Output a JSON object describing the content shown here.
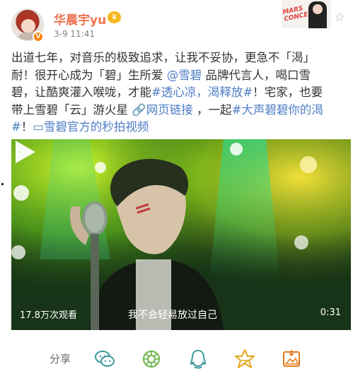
{
  "header": {
    "username": "华晨宇yu",
    "timestamp": "3-9 11:41",
    "verified_badge": "V",
    "member_icon": "crown-icon",
    "card_script": "MARS CONCERT"
  },
  "post": {
    "lines": [
      [
        {
          "t": "出道七年，对音乐的极致追求，让我不妥协，更急不「渴」"
        }
      ],
      [
        {
          "t": "耐！很开心成为「碧」生所爱 "
        },
        {
          "t": "@雪碧",
          "link": true
        },
        {
          "t": " 品牌代言人，喝口雪"
        }
      ],
      [
        {
          "t": "碧，让酷爽灌入喉咙，才能"
        },
        {
          "t": "#透心凉，渴释放#",
          "link": true
        },
        {
          "t": "！宅家，也要"
        }
      ],
      [
        {
          "t": "带上雪碧「云」游火星 "
        },
        {
          "t": "🔗网页链接",
          "link": true
        },
        {
          "t": " ，一起"
        },
        {
          "t": "#大声碧碧你的渴",
          "link": true
        }
      ],
      [
        {
          "t": "#",
          "link": true
        },
        {
          "t": "！"
        },
        {
          "t": "▭雪碧官方的秒拍视频",
          "link": true
        }
      ]
    ]
  },
  "video": {
    "views": "17.8万次观看",
    "subtitle": "我不会轻易放过自己",
    "duration": "0:31"
  },
  "actions": {
    "share_label": "分享",
    "icons": [
      "wechat-icon",
      "moments-icon",
      "qq-icon",
      "qzone-icon",
      "save-image-icon"
    ]
  },
  "colors": {
    "username": "#eb7350",
    "link": "#4d7cc4",
    "verified": "#ff8200",
    "action_icons": "#3d9b9c"
  }
}
